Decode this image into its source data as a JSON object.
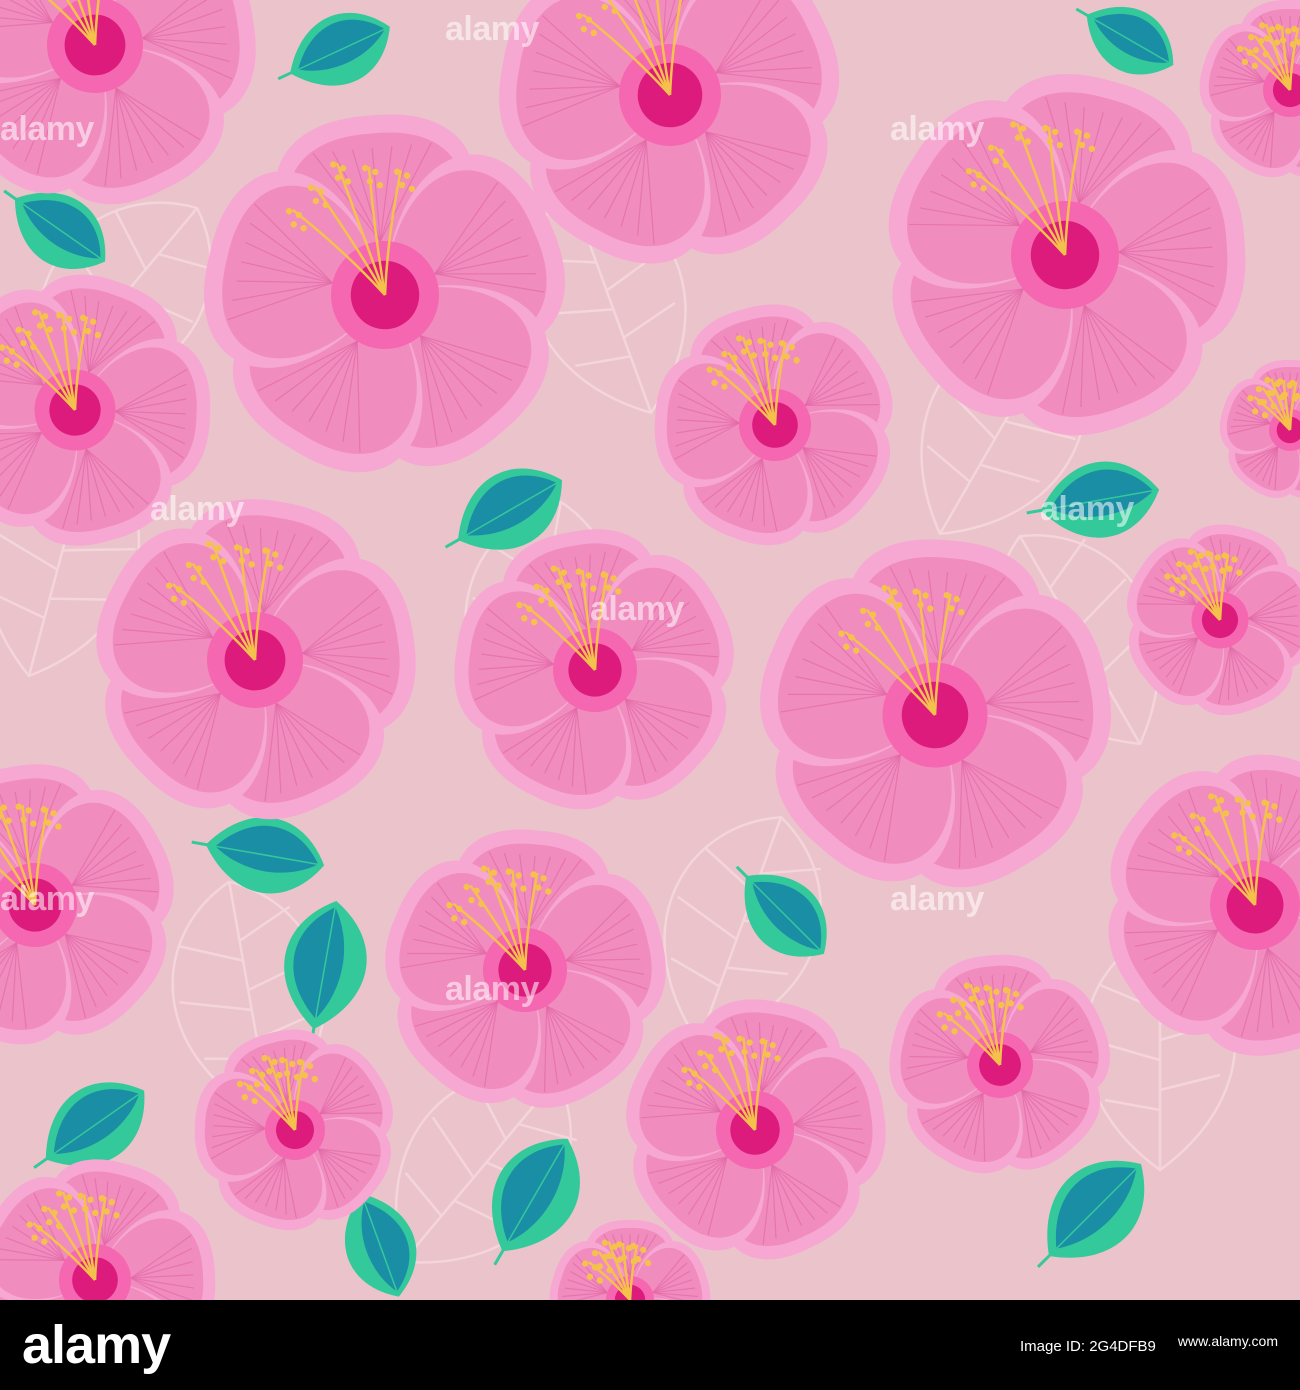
{
  "palette": {
    "background": "#ebc3cb",
    "petal": "#f18cbe",
    "petal_edge": "#f6a8d2",
    "petal_stroke": "#e26aa8",
    "center_ring": "#f567b0",
    "center": "#dc1b7d",
    "stamen": "#f4c24c",
    "leaf_light": "#34c99a",
    "leaf_dark": "#1a8ea4",
    "outline": "#f7dbe1"
  },
  "watermark": {
    "text": "alamy"
  },
  "footer": {
    "logo": "alamy",
    "image_id": "Image ID: 2G4DFB9",
    "site": "www.alamy.com"
  }
}
